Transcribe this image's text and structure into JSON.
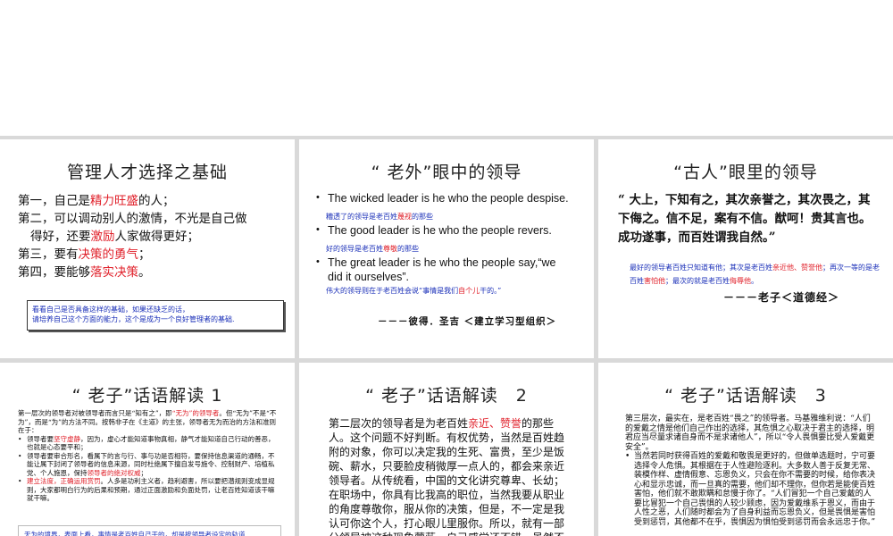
{
  "slides": [
    {
      "title": "管理人才选择之基础",
      "lines": [
        {
          "pre": "第一，自己是",
          "hl": "精力旺盛",
          "post": "的人；"
        },
        {
          "pre": "第二，可以调动别人的激情，不光是自己做",
          "hl": "",
          "post": ""
        },
        {
          "pre": "得好，还要",
          "hl": "激励",
          "post": "人家做得更好；"
        },
        {
          "pre": "第三，要有",
          "hl": "决策的勇气",
          "post": "；"
        },
        {
          "pre": "第四，要能够",
          "hl": "落实决策",
          "post": "。"
        }
      ],
      "note_line1": "看看自己是否具备这样的基础，如果还缺乏的话，",
      "note_line2": "请培养自己这个方面的能力，这个是成为一个良好管理者的基础."
    },
    {
      "title": "“ 老外”眼中的领导",
      "bullets": [
        {
          "en": "The wicked leader is he who the people despise.",
          "zh_pre": "糟透了的领导是老百姓",
          "zh_hl": "蔑视",
          "zh_post": "的那些"
        },
        {
          "en": "The good leader is he who the people revers.",
          "zh_pre": "好的领导是老百姓",
          "zh_hl": "尊敬",
          "zh_post": "的那些"
        },
        {
          "en": "The great leader is he who the people say,“we",
          "en2": "did it ourselves”.",
          "zh_pre": "伟大的领导则在于老百姓会说“事情是我们",
          "zh_hl": "自个儿",
          "zh_post": "干的。”"
        }
      ],
      "attribution": "－－－彼得．圣吉 ＜建立学习型组织＞"
    },
    {
      "title": "“古人”眼里的领导",
      "quote": "“ 大上，下知有之，其次亲誉之，其次畏之，其下侮之。信不足，案有不信。猷呵！贵其言也。成功遂事，而百姓谓我自然。”",
      "expl_1": "最好的领导者百姓只知道有他；其次是老百姓",
      "expl_hl1": "亲近他、赞誉他",
      "expl_2": "；再次一等的是老百姓",
      "expl_hl2": "害怕他",
      "expl_3": "；最次的就是老百姓",
      "expl_hl3": "侮辱他",
      "expl_4": "。",
      "attribution": "－－－老子＜道德经＞"
    },
    {
      "title": "“ 老子”话语解读 1",
      "text_a": "第一层次的领导者对被领导者而言只是“知有之”，即",
      "text_a_hl": "“无为”的领导者",
      "text_a2": "。但“无为”不是“不为”，而是“为”的方法不同。按韩非子在《主道》的主张，领导者无为而治的方法和准则在于：",
      "bullets": [
        {
          "pre": "领导者要",
          "hl": "坚守虚静",
          "post": "，因为，虚心才能知道事物真相，静气才能知道自己行动的善恶，也就是心态要平和；"
        },
        {
          "pre": "领导者要审合形名，看属下的言与行、事与功是否相符，要保持信息渠道的通畅，不能让属下封闭了领导者的信息来源，同时杜绝属下擅自发号施令、控制财产、培植私党、个人施恩，保持",
          "hl": "领导者的绝对权威",
          "post": "；"
        },
        {
          "pre": "",
          "hl": "建立法度，正确运用赏罚",
          "post": "。人多是功利主义者，趋利避害，所以要把潜规则变成显规则，大家都明白行为的后果和预期，通过正面激励和负面处罚，让老百姓知道该干嘛就干嘛。"
        }
      ],
      "note": "无为的境界，表面上看，事情是老百姓自己干的，却是按领导者设定的轨道"
    },
    {
      "title": "“ 老子”话语解读　2",
      "para_pre": "第二层次的领导者是为老百姓",
      "para_hl": "亲近、赞誉",
      "para_post": "的那些人。这个问题不好判断。有权优势，当然是百姓趋附的对象，你可以决定我的生死、富贵，至少是饭碗、薪水，只要脸皮稍微厚一点人的，都会来亲近领导者。从传统看，中国的文化讲究尊卑、长幼；在职场中，你具有比我高的职位，当然我要从职业的角度尊敬你，服从你的决策，但是，不一定是我认可你这个人，打心眼儿里服你。所以，就有一部分领导被这种现象蒙蔽，自己感觉还不错，虽然不是无为而治，但也达到了收百姓之心的目的。"
    },
    {
      "title": "“ 老子”话语解读　3",
      "text_a": "第三层次，最实在，是老百姓“畏之”的领导者。马基雅维利说：“人们的爱戴之情是他们自己作出的选择，其危惧之心取决于君主的选择，明君应当尽量求诸自身而不是求诸他人”，所以“令人畏惧要比受人爱戴更安全”。",
      "bullet": "当然若同时获得百姓的爱戴和敬畏是更好的，但做单选题时，宁可要选择令人危惧。其根据在于人性避险逐利。大多数人善于反复无常、装模作样、虚情假意、忘恩负义，只会在你不需要的时候，给你表决心和显示忠诚，而一旦真的需要，他们却不理你，但你若是能使百姓害怕，他们就不敢欺瞒和怠慢于你了。“人们冒犯一个自己爱戴的人要比冒犯一个自己畏惧的人较少顾虑，因为爱戴维系于恩义，而由于人性之恶，人们随时都会为了自身利益而忘恩负义，但是畏惧是害怕受到惩罚，其他都不在乎，畏惧因为惧怕受到惩罚而会永远忠于你。”"
    }
  ]
}
